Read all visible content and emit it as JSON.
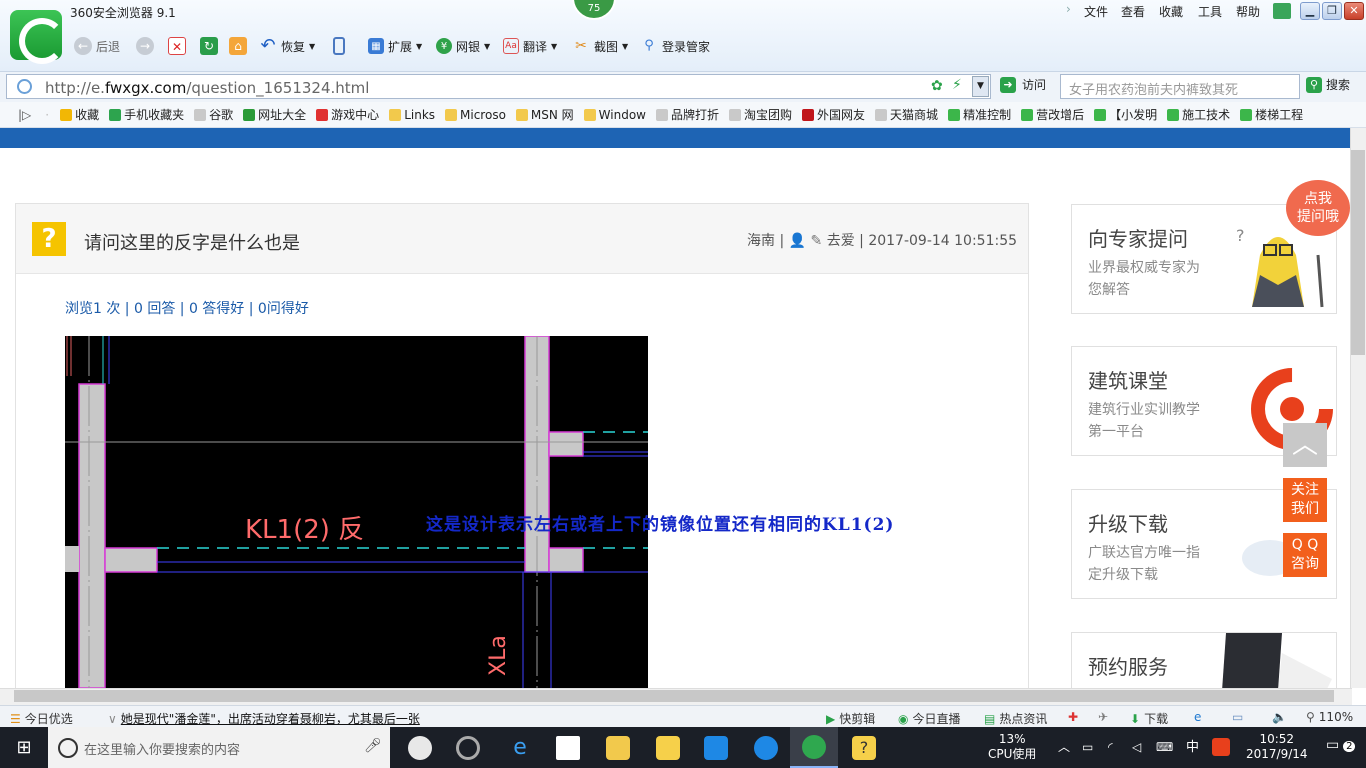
{
  "browser": {
    "app_title": "360安全浏览器 9.1",
    "badge_count": "75",
    "menu": [
      "文件",
      "查看",
      "收藏",
      "工具",
      "帮助"
    ],
    "toolbar": {
      "back": "后退",
      "restore": "恢复",
      "extend": "扩展",
      "netbank": "网银",
      "translate": "翻译",
      "screenshot": "截图",
      "login_manager": "登录管家"
    },
    "address": {
      "url_prefix": "http://e.",
      "url_domain": "fwxgx.com",
      "url_path": "/question_1651324.html",
      "visit_label": "访问",
      "search_placeholder": "女子用农药泡前夫内裤致其死",
      "search_label": "搜索"
    },
    "favorites": [
      {
        "label": "收藏",
        "color": "#f2b705"
      },
      {
        "label": "手机收藏夹",
        "color": "#2da44e"
      },
      {
        "label": "谷歌",
        "color": "#c9c9c9"
      },
      {
        "label": "网址大全",
        "color": "#2b9b38"
      },
      {
        "label": "游戏中心",
        "color": "#e03131"
      },
      {
        "label": "Links",
        "color": "#f2c94c"
      },
      {
        "label": "Microso",
        "color": "#f2c94c"
      },
      {
        "label": "MSN 网",
        "color": "#f2c94c"
      },
      {
        "label": "Window",
        "color": "#f2c94c"
      },
      {
        "label": "品牌打折",
        "color": "#c9c9c9"
      },
      {
        "label": "淘宝团购",
        "color": "#c9c9c9"
      },
      {
        "label": "外国网友",
        "color": "#c0161b"
      },
      {
        "label": "天猫商城",
        "color": "#c9c9c9"
      },
      {
        "label": "精准控制",
        "color": "#3cb64a"
      },
      {
        "label": "营改增后",
        "color": "#3cb64a"
      },
      {
        "label": "【小发明",
        "color": "#3cb64a"
      },
      {
        "label": "施工技术",
        "color": "#3cb64a"
      },
      {
        "label": "楼梯工程",
        "color": "#3cb64a"
      }
    ]
  },
  "question": {
    "title": "请问这里的反字是什么也是",
    "region": "海南",
    "user": "去爱",
    "datetime": "2017-09-14 10:51:55",
    "stats": "浏览1 次 | 0 回答 | 0 答得好 | 0问得好",
    "image_label": "KL1(2) 反",
    "image_label_2": "XLa",
    "caption": "这是设计表示左右或者上下的镜像位置还有相同的KL1(2)"
  },
  "sidebar": {
    "bubble": [
      "点我",
      "提问哦"
    ],
    "cards": [
      {
        "title": "向专家提问",
        "subtitle": "业界最权威专家为您解答"
      },
      {
        "title": "建筑课堂",
        "subtitle": "建筑行业实训教学第一平台"
      },
      {
        "title": "升级下载",
        "subtitle": "广联达官方唯一指定升级下载"
      },
      {
        "title": "预约服务",
        "subtitle": ""
      }
    ],
    "follow": [
      "关注",
      "我们"
    ],
    "qq": [
      "Q Q",
      "咨询"
    ]
  },
  "statusbar": {
    "today_pick": "今日优选",
    "news": "她是现代\"潘金莲\"，出席活动穿着聂柳岩，尤其最后一张",
    "quick_clip": "快剪辑",
    "today_live": "今日直播",
    "hot_news": "热点资讯",
    "download": "下载",
    "zoom": "110%"
  },
  "taskbar": {
    "search_placeholder": "在这里输入你要搜索的内容",
    "cpu_percent": "13%",
    "cpu_label": "CPU使用",
    "ime": "中",
    "time": "10:52",
    "date": "2017/9/14",
    "notifications": "2"
  }
}
